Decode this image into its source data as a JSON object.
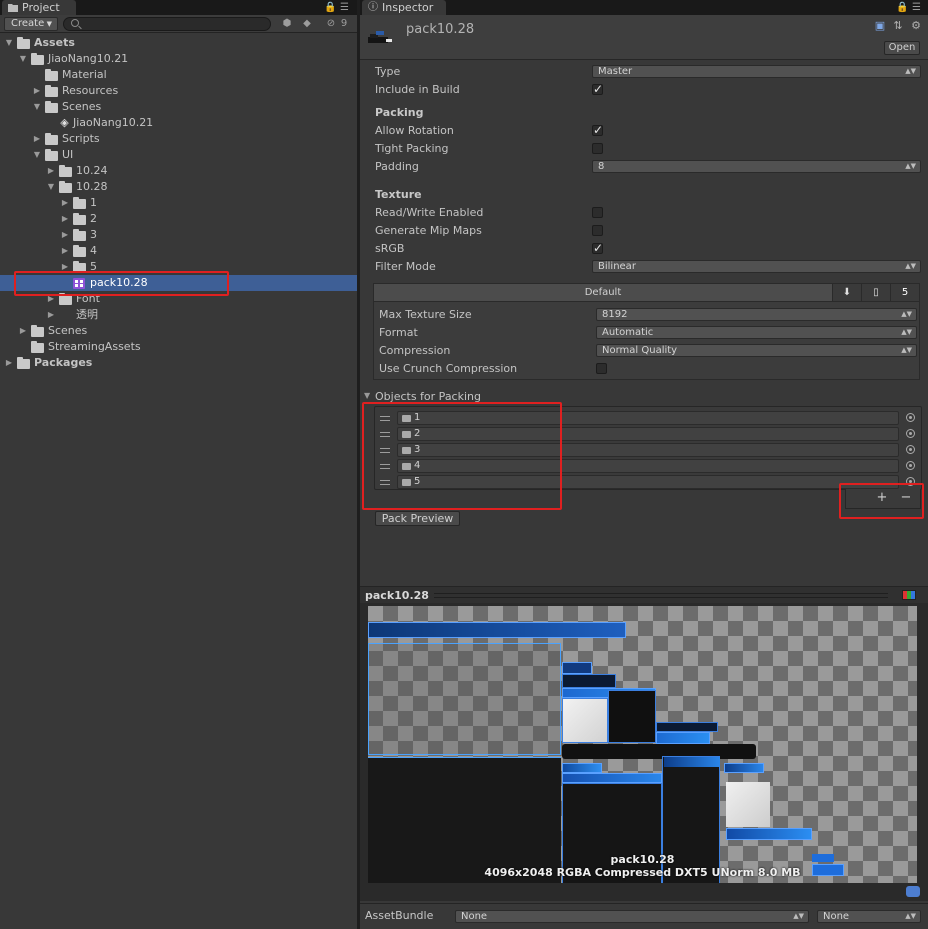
{
  "project": {
    "tab_label": "Project",
    "create_label": "Create",
    "search_placeholder": "",
    "hidden_count": "9",
    "tree": [
      {
        "label": "Assets",
        "depth": 0,
        "expanded": true,
        "bold": true,
        "kind": "folder"
      },
      {
        "label": "JiaoNang10.21",
        "depth": 1,
        "expanded": true,
        "kind": "folder"
      },
      {
        "label": "Material",
        "depth": 2,
        "expanded": null,
        "kind": "folder"
      },
      {
        "label": "Resources",
        "depth": 2,
        "expanded": false,
        "kind": "folder"
      },
      {
        "label": "Scenes",
        "depth": 2,
        "expanded": true,
        "kind": "folder"
      },
      {
        "label": "JiaoNang10.21",
        "depth": 3,
        "expanded": null,
        "kind": "scene"
      },
      {
        "label": "Scripts",
        "depth": 2,
        "expanded": false,
        "kind": "folder"
      },
      {
        "label": "UI",
        "depth": 2,
        "expanded": true,
        "kind": "folder"
      },
      {
        "label": "10.24",
        "depth": 3,
        "expanded": false,
        "kind": "folder"
      },
      {
        "label": "10.28",
        "depth": 3,
        "expanded": true,
        "kind": "folder"
      },
      {
        "label": "1",
        "depth": 4,
        "expanded": false,
        "kind": "folder"
      },
      {
        "label": "2",
        "depth": 4,
        "expanded": false,
        "kind": "folder"
      },
      {
        "label": "3",
        "depth": 4,
        "expanded": false,
        "kind": "folder"
      },
      {
        "label": "4",
        "depth": 4,
        "expanded": false,
        "kind": "folder"
      },
      {
        "label": "5",
        "depth": 4,
        "expanded": false,
        "kind": "folder"
      },
      {
        "label": "pack10.28",
        "depth": 4,
        "expanded": null,
        "kind": "atlas",
        "selected": true
      },
      {
        "label": "Font",
        "depth": 3,
        "expanded": false,
        "kind": "folder"
      },
      {
        "label": "透明",
        "depth": 3,
        "expanded": false,
        "kind": "none"
      },
      {
        "label": "Scenes",
        "depth": 1,
        "expanded": false,
        "kind": "folder"
      },
      {
        "label": "StreamingAssets",
        "depth": 1,
        "expanded": null,
        "kind": "folder"
      },
      {
        "label": "Packages",
        "depth": 0,
        "expanded": false,
        "bold": true,
        "kind": "folder"
      }
    ]
  },
  "inspector": {
    "tab_label": "Inspector",
    "asset_name": "pack10.28",
    "open_label": "Open",
    "type_label": "Type",
    "type_value": "Master",
    "include_label": "Include in Build",
    "include_checked": true,
    "packing_title": "Packing",
    "allow_rotation_label": "Allow Rotation",
    "allow_rotation_checked": true,
    "tight_packing_label": "Tight Packing",
    "tight_packing_checked": false,
    "padding_label": "Padding",
    "padding_value": "8",
    "texture_title": "Texture",
    "readwrite_label": "Read/Write Enabled",
    "readwrite_checked": false,
    "mipmaps_label": "Generate Mip Maps",
    "mipmaps_checked": false,
    "srgb_label": "sRGB",
    "srgb_checked": true,
    "filter_label": "Filter Mode",
    "filter_value": "Bilinear",
    "platform_default": "Default",
    "max_size_label": "Max Texture Size",
    "max_size_value": "8192",
    "format_label": "Format",
    "format_value": "Automatic",
    "compression_label": "Compression",
    "compression_value": "Normal Quality",
    "crunch_label": "Use Crunch Compression",
    "crunch_checked": false,
    "objects_title": "Objects for Packing",
    "objects": [
      "1",
      "2",
      "3",
      "4",
      "5"
    ],
    "plus_label": "+",
    "minus_label": "−",
    "pack_preview_label": "Pack Preview",
    "preview_title": "pack10.28",
    "preview_caption_name": "pack10.28",
    "preview_caption_info": "4096x2048 RGBA Compressed DXT5 UNorm   8.0 MB",
    "assetbundle_label": "AssetBundle",
    "assetbundle_value": "None",
    "assetbundle_variant": "None"
  },
  "colors": {
    "selection": "#3e5f96",
    "annotation_red": "#e02020",
    "atlas_purple": "#8d52d8"
  }
}
